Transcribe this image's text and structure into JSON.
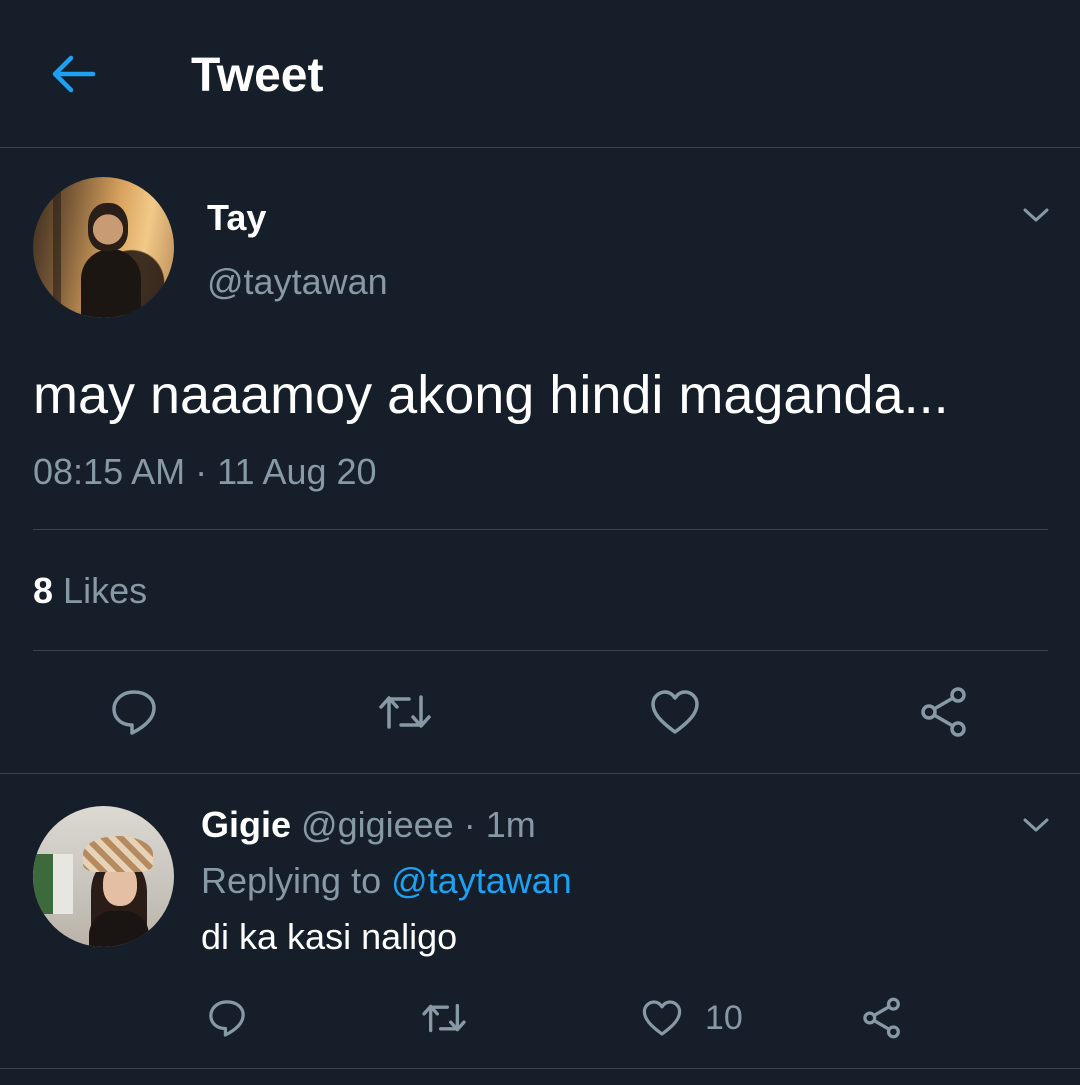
{
  "header": {
    "title": "Tweet",
    "back_icon": "arrow-left-icon"
  },
  "colors": {
    "background": "#151e29",
    "accent": "#1da1f2",
    "secondary_text": "#8899a6",
    "divider": "#38444d"
  },
  "tweet": {
    "author_name": "Tay",
    "author_handle": "@taytawan",
    "text": "may naaamoy akong hindi maganda...",
    "timestamp": "08:15 AM · 11 Aug 20",
    "likes_count": "8",
    "likes_label": "Likes",
    "actions": [
      "reply-icon",
      "retweet-icon",
      "like-icon",
      "share-icon"
    ]
  },
  "reply": {
    "author_name": "Gigie",
    "author_handle": "@gigieee",
    "separator": "·",
    "time": "1m",
    "replying_prefix": "Replying to",
    "replying_handle": "@taytawan",
    "text": "di ka kasi naligo",
    "like_count": "10",
    "actions": [
      "reply-icon",
      "retweet-icon",
      "like-icon",
      "share-icon"
    ]
  }
}
